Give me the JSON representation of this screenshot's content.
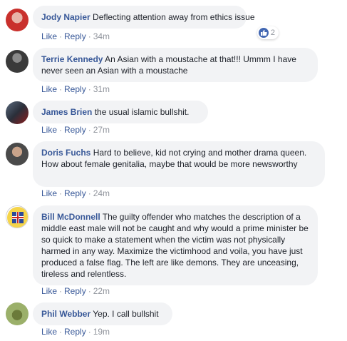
{
  "actions": {
    "like_label": "Like",
    "reply_label": "Reply",
    "separator": "·"
  },
  "comments": [
    {
      "author": "Jody Napier",
      "text": "Deflecting attention away from ethics issue",
      "time": "34m",
      "reaction_count": "2",
      "avatar": "woman-profile-photo"
    },
    {
      "author": "Terrie Kennedy",
      "text": "An Asian with a moustache at that!!! Ummm I have never seen an Asian with a moustache",
      "time": "31m",
      "avatar": "dark-profile-photo"
    },
    {
      "author": "James Brien",
      "text": "the usual islamic bullshit.",
      "time": "27m",
      "avatar": "group-profile-photo"
    },
    {
      "author": "Doris Fuchs",
      "text": "Hard to believe, kid not crying and mother drama queen. How about female genitalia, maybe that would be more newsworthy",
      "time": "24m",
      "avatar": "man-profile-photo"
    },
    {
      "author": "Bill McDonnell",
      "text": "The guilty offender who matches the description of a middle east male will not be caught and why would a prime minister be so quick to make a statement when the victim was not physically harmed in any way. Maximize the victimhood and voila, you have just produced a false flag. The left are like demons. They are unceasing, tireless and relentless.",
      "time": "22m",
      "avatar": "flag-emblem-photo"
    },
    {
      "author": "Phil Webber",
      "text": "Yep. I call bullshit",
      "time": "19m",
      "avatar": "outdoor-profile-photo"
    }
  ]
}
